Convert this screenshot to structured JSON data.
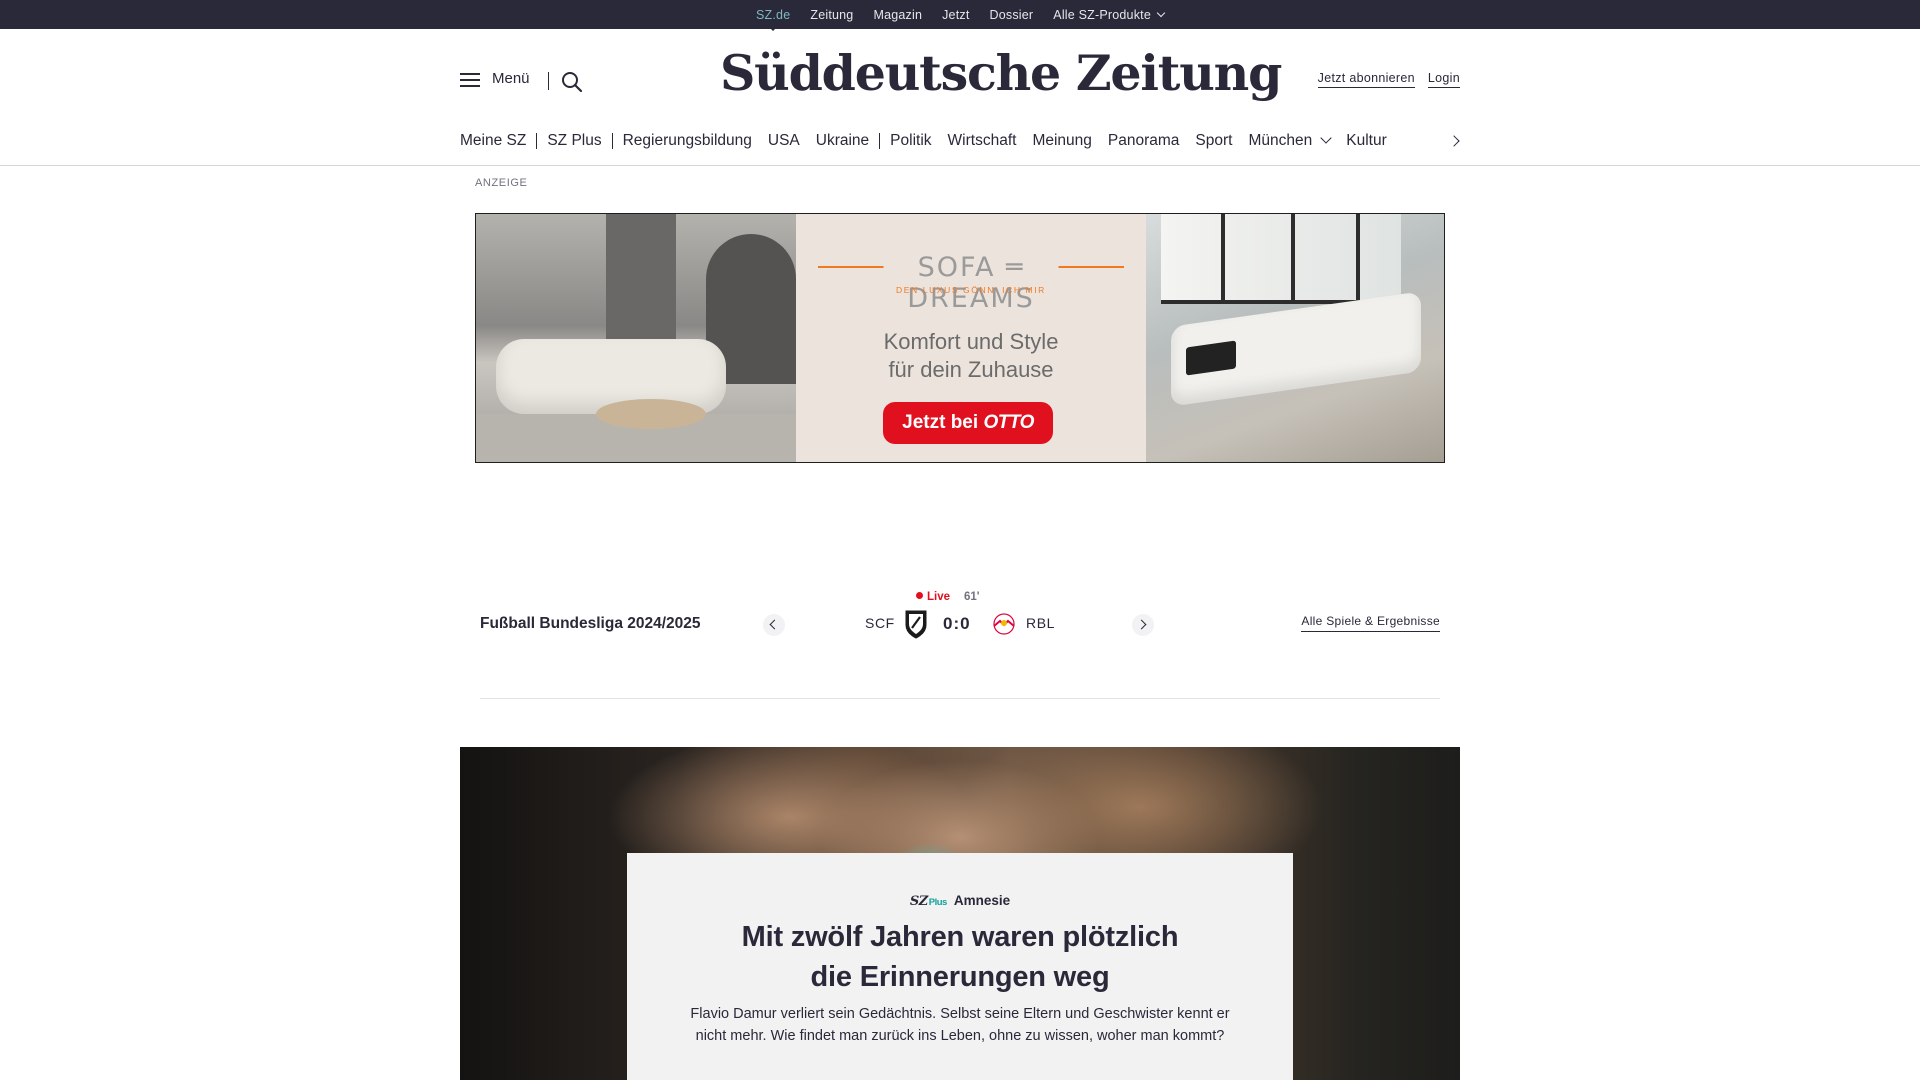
{
  "topbar": {
    "items": [
      "SZ.de",
      "Zeitung",
      "Magazin",
      "Jetzt",
      "Dossier",
      "Alle SZ-Produkte"
    ]
  },
  "header": {
    "menu_label": "Menü",
    "logo_text": "Süddeutsche Zeitung",
    "subscribe_label": "Jetzt abonnieren",
    "login_label": "Login"
  },
  "nav": {
    "items": [
      "Meine SZ",
      "SZ Plus",
      "Regierungsbildung",
      "USA",
      "Ukraine",
      "Politik",
      "Wirtschaft",
      "Meinung",
      "Panorama",
      "Sport",
      "München",
      "Kultur"
    ]
  },
  "ad": {
    "label": "ANZEIGE",
    "brand": "SOFA ═ DREAMS",
    "tagline": "DEN LUXUS GÖNN' ICH MIR",
    "copy_line1": "Komfort und Style",
    "copy_line2": "für dein Zuhause",
    "cta_prefix": "Jetzt bei ",
    "cta_brand": "OTTO"
  },
  "score": {
    "league": "Fußball Bundesliga 2024/2025",
    "live_label": "Live",
    "minute": "61'",
    "home_team": "SCF",
    "result": "0:0",
    "away_team": "RBL",
    "all_games_label": "Alle Spiele & Ergebnisse"
  },
  "teaser": {
    "badge_sz": "SZ",
    "badge_plus": "Plus",
    "kicker": "Amnesie",
    "headline_line1": "Mit zwölf Jahren waren plötzlich",
    "headline_line2": "die Erinnerungen weg",
    "text": "Flavio Damur verliert sein Gedächtnis. Selbst seine Eltern und Geschwister kennt er nicht mehr. Wie findet man zurück ins Leben, ohne zu wissen, woher man kommt?"
  },
  "colors": {
    "brand_dark": "#29293a",
    "topbar_active": "#7fb7c2",
    "live_red": "#e0101f",
    "sz_plus_teal": "#12a29e",
    "ad_orange": "#f07a22"
  }
}
